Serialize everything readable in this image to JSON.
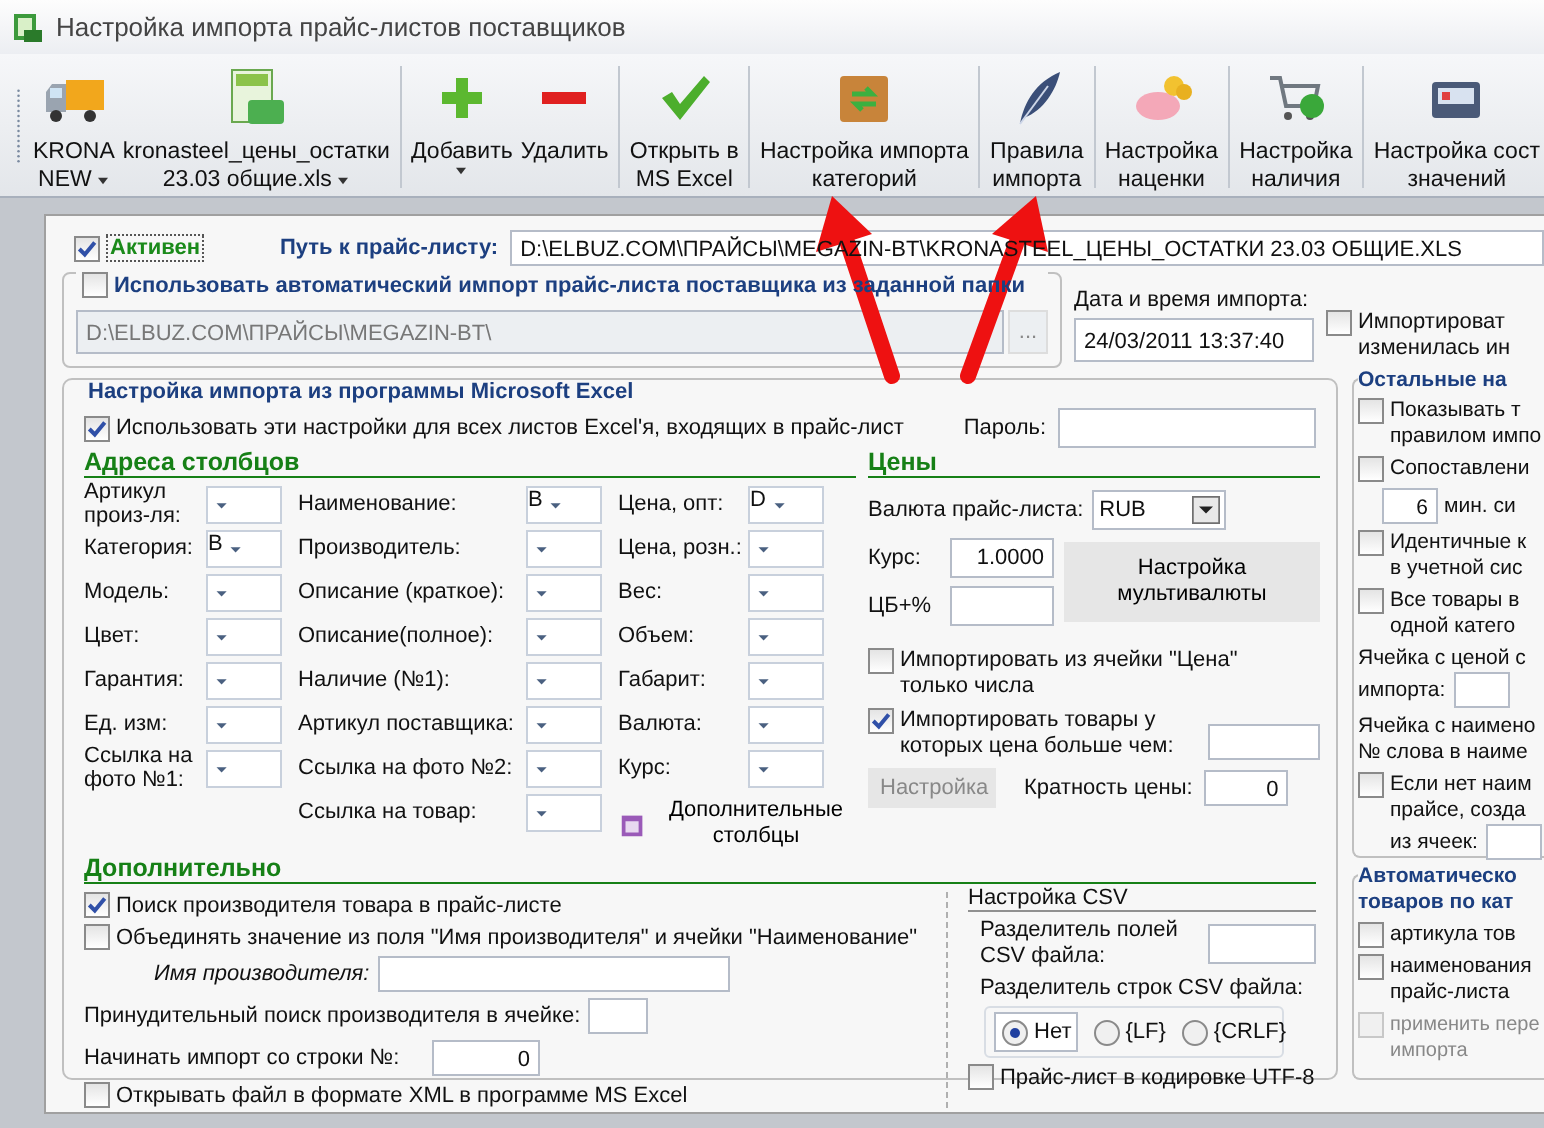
{
  "window": {
    "title": "Настройка импорта прайс-листов поставщиков"
  },
  "toolbar": [
    {
      "kind": "truck",
      "lines": [
        "KRONA",
        "NEW"
      ],
      "menu": true,
      "separator_after": false
    },
    {
      "kind": "xls",
      "lines": [
        "kronasteel_цены_остатки",
        "23.03 общие.xls"
      ],
      "menu": true,
      "separator_after": true
    },
    {
      "kind": "plus",
      "lines": [
        "Добавить"
      ],
      "menu": true,
      "separator_after": false
    },
    {
      "kind": "minus",
      "lines": [
        "Удалить"
      ],
      "menu": false,
      "separator_after": true
    },
    {
      "kind": "check",
      "lines": [
        "Открыть в",
        "MS Excel"
      ],
      "menu": false,
      "separator_after": true
    },
    {
      "kind": "box",
      "lines": [
        "Настройка импорта",
        "категорий"
      ],
      "menu": false,
      "separator_after": true
    },
    {
      "kind": "feather",
      "lines": [
        "Правила",
        "импорта"
      ],
      "menu": false,
      "separator_after": true
    },
    {
      "kind": "pig",
      "lines": [
        "Настройка",
        "наценки"
      ],
      "menu": false,
      "separator_after": true
    },
    {
      "kind": "cart",
      "lines": [
        "Настройка",
        "наличия"
      ],
      "menu": false,
      "separator_after": true
    },
    {
      "kind": "case",
      "lines": [
        "Настройка сост",
        "значений"
      ],
      "menu": false,
      "separator_after": false
    }
  ],
  "active": {
    "label": "Активен",
    "checked": true
  },
  "path": {
    "label": "Путь к прайс-листу:",
    "value": "D:\\ELBUZ.COM\\ПРАЙСЫ\\MEGAZIN-BT\\KRONASTEEL_ЦЕНЫ_ОСТАТКИ 23.03 ОБЩИЕ.XLS"
  },
  "auto_import": {
    "label": "Использовать автоматический импорт прайс-листа поставщика из заданной папки",
    "checked": false,
    "folder": "D:\\ELBUZ.COM\\ПРАЙСЫ\\MEGAZIN-BT\\",
    "browse": "...",
    "date_label": "Дата и время импорта:",
    "date": "24/03/2011 13:37:40",
    "changed": {
      "lines": [
        "Импортироват",
        "изменилась ин"
      ],
      "checked": false
    }
  },
  "excel": {
    "legend": "Настройка импорта из программы Microsoft Excel",
    "all_sheets": {
      "label": "Использовать эти настройки для всех листов Excel'я, входящих в прайс-лист",
      "checked": true
    },
    "password_label": "Пароль:",
    "columns_title": "Адреса столбцов",
    "columns": [
      [
        {
          "label": "Артикул произ-ля:"
        },
        {
          "label": "Категория:",
          "value": "B"
        },
        {
          "label": "Модель:"
        },
        {
          "label": "Цвет:"
        },
        {
          "label": "Гарантия:"
        },
        {
          "label": "Ед. изм:"
        },
        {
          "label": "Ссылка на фото №1:"
        }
      ],
      [
        {
          "label": "Наименование:",
          "value": "B"
        },
        {
          "label": "Производитель:"
        },
        {
          "label": "Описание (краткое):"
        },
        {
          "label": "Описание(полное):"
        },
        {
          "label": "Наличие (№1):"
        },
        {
          "label": "Артикул поставщика:"
        },
        {
          "label": "Ссылка на фото №2:"
        },
        {
          "label": "Ссылка на товар:"
        }
      ],
      [
        {
          "label": "Цена, опт:",
          "value": "D"
        },
        {
          "label": "Цена, розн.:"
        },
        {
          "label": "Вес:"
        },
        {
          "label": "Объем:"
        },
        {
          "label": "Габарит:"
        },
        {
          "label": "Валюта:"
        },
        {
          "label": "Курс:"
        }
      ]
    ],
    "extra_columns": "Дополнительные столбцы",
    "prices": {
      "title": "Цены",
      "currency_label": "Валюта прайс-листа:",
      "currency": "RUB",
      "rate_label": "Курс:",
      "rate": "1.0000",
      "cb_label": "ЦБ+%",
      "multi_button": "Настройка мультивалюты",
      "numbers_only": {
        "label": "Импортировать из ячейки \"Цена\" только числа",
        "checked": false
      },
      "min_price": {
        "label": "Импортировать товары у которых цена больше чем:",
        "checked": true
      },
      "setup_button": "Настройка",
      "multiple_label": "Кратность цены:",
      "multiple": "0"
    }
  },
  "extra": {
    "title": "Дополнительно",
    "find_maker": {
      "label": "Поиск производителя товара в прайс-листе",
      "checked": true
    },
    "merge": {
      "label": "Объединять значение из поля \"Имя производителя\" и ячейки \"Наименование\"",
      "checked": false
    },
    "maker_name_label": "Имя производителя:",
    "force_label": "Принудительный поиск производителя в ячейке:",
    "start_label": "Начинать импорт со строки №:",
    "start": "0",
    "xml": {
      "label": "Открывать файл в формате XML в программе MS Excel",
      "checked": false
    },
    "csv": {
      "title": "Настройка CSV",
      "field_sep_label": "Разделитель полей CSV файла:",
      "row_sep_label": "Разделитель строк CSV файла:",
      "row_seps": [
        {
          "label": "Нет",
          "selected": true
        },
        {
          "label": "{LF}",
          "selected": false
        },
        {
          "label": "{CRLF}",
          "selected": false
        }
      ],
      "utf8": {
        "label": "Прайс-лист в кодировке UTF-8",
        "checked": false
      }
    }
  },
  "other": {
    "title": "Остальные на",
    "items": [
      {
        "kind": "check",
        "lines": [
          "Показывать т",
          "правилом импо"
        ],
        "checked": false
      },
      {
        "kind": "check",
        "lines": [
          "Сопоставлени"
        ],
        "checked": false
      },
      {
        "kind": "spin",
        "value": "6",
        "suffix": "мин. си"
      },
      {
        "kind": "check",
        "lines": [
          "Идентичные к",
          "в учетной сис"
        ],
        "checked": false
      },
      {
        "kind": "check",
        "lines": [
          "Все товары в",
          "одной катего"
        ],
        "checked": false
      },
      {
        "kind": "text",
        "lines": [
          "Ячейка с ценой с",
          "импорта:"
        ],
        "field": true
      },
      {
        "kind": "text",
        "lines": [
          "Ячейка с наимено",
          "№ слова в наиме"
        ],
        "field": false
      },
      {
        "kind": "check",
        "lines": [
          "Если нет наим",
          "прайсе, созда",
          "из ячеек:"
        ],
        "checked": false,
        "field": true
      }
    ]
  },
  "auto_cat": {
    "title_lines": [
      "Автоматическо",
      "товаров по кат"
    ],
    "items": [
      {
        "lines": [
          "артикула тов"
        ],
        "checked": false,
        "disabled": false
      },
      {
        "lines": [
          "наименования",
          "прайс-листа"
        ],
        "checked": false,
        "disabled": false
      },
      {
        "lines": [
          "применить пере",
          "импорта"
        ],
        "checked": false,
        "disabled": true
      }
    ]
  }
}
